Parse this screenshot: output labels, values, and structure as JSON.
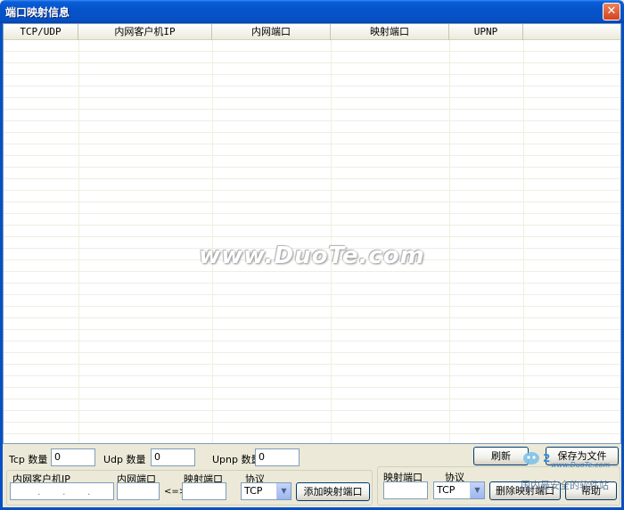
{
  "window": {
    "title": "端口映射信息",
    "close_glyph": "✕"
  },
  "table": {
    "columns": [
      "TCP/UDP",
      "内网客户机IP",
      "内网端口",
      "映射端口",
      "UPNP"
    ]
  },
  "watermark": "www.DuoTe.com",
  "stats": {
    "tcp_label": "Tcp 数量",
    "tcp_value": "0",
    "udp_label": "Udp 数量",
    "udp_value": "0",
    "upnp_label": "Upnp 数量",
    "upnp_value": "0"
  },
  "buttons": {
    "refresh": "刷新",
    "save_file": "保存为文件",
    "add_mapping": "添加映射端口",
    "delete_mapping": "删除映射端口",
    "help": "帮助"
  },
  "add_form": {
    "ip_label": "内网客户机IP",
    "ip_dots": [
      ".",
      ".",
      "."
    ],
    "internal_port_label": "内网端口",
    "arrow": "<=>",
    "mapped_port_label": "映射端口",
    "protocol_label": "协议",
    "protocol_value": "TCP"
  },
  "delete_form": {
    "mapped_port_label": "映射端口",
    "protocol_label": "协议",
    "protocol_value": "TCP"
  },
  "logo": {
    "domain": "www.DuoTe.com",
    "tagline": "国内最安全的软件站"
  }
}
